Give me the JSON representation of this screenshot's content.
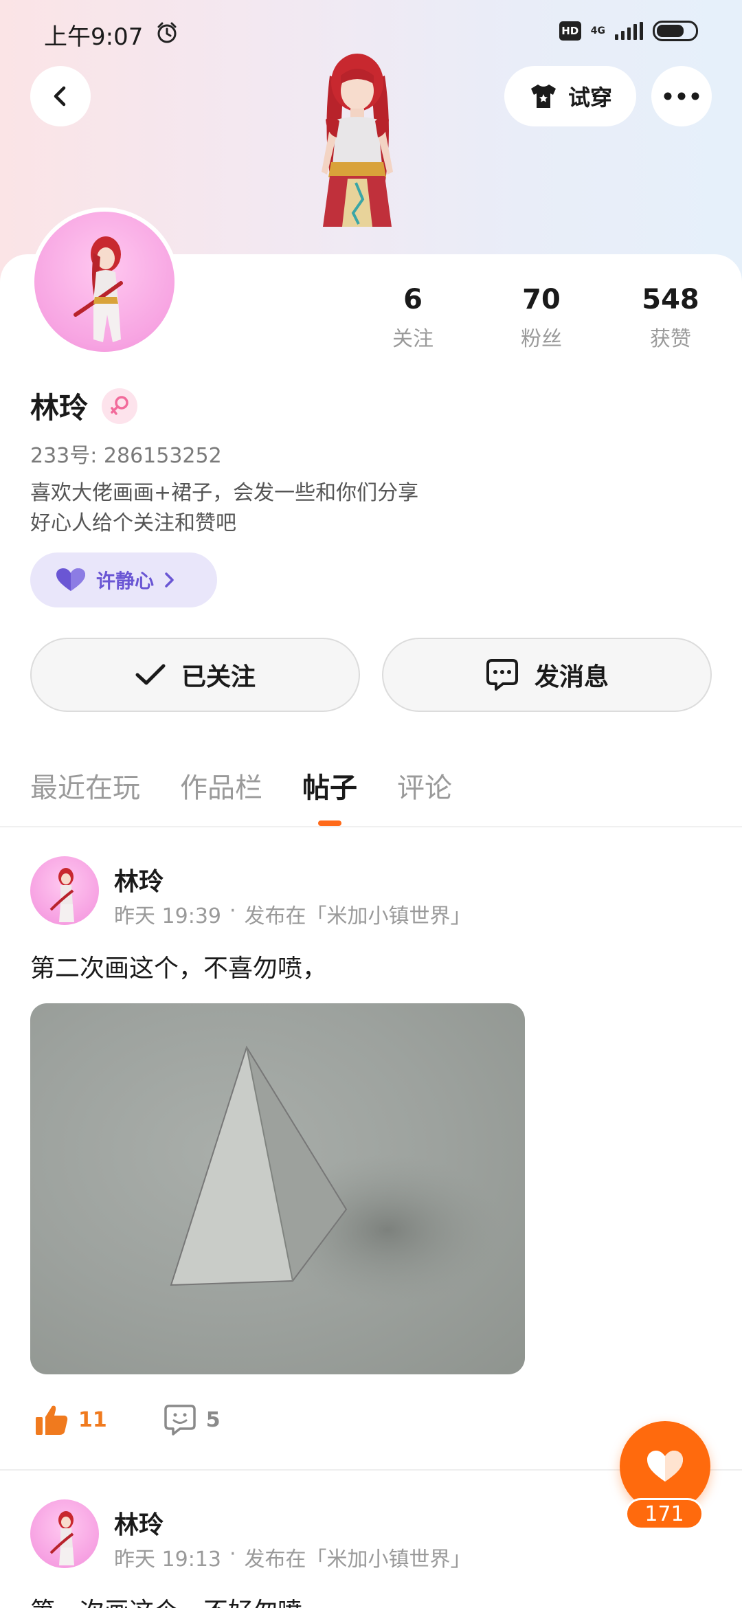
{
  "status_bar": {
    "time": "上午9:07",
    "hd": "HD",
    "network": "4G"
  },
  "header": {
    "try_on_label": "试穿"
  },
  "profile": {
    "stats": [
      {
        "value": "6",
        "label": "关注"
      },
      {
        "value": "70",
        "label": "粉丝"
      },
      {
        "value": "548",
        "label": "获赞"
      }
    ],
    "name": "林玲",
    "uid": "233号: 286153252",
    "bio_line1": "喜欢大佬画画+裙子，会发一些和你们分享",
    "bio_line2": "好心人给个关注和赞吧",
    "guild_label": "许静心"
  },
  "actions": {
    "follow_label": "已关注",
    "message_label": "发消息"
  },
  "tabs": [
    {
      "label": "最近在玩",
      "active": false
    },
    {
      "label": "作品栏",
      "active": false
    },
    {
      "label": "帖子",
      "active": true
    },
    {
      "label": "评论",
      "active": false
    }
  ],
  "posts": [
    {
      "author": "林玲",
      "time": "昨天 19:39",
      "place": "发布在「米加小镇世界」",
      "text": "第二次画这个，不喜勿喷，",
      "likes": "11",
      "comments": "5"
    },
    {
      "author": "林玲",
      "time": "昨天 19:13",
      "place": "发布在「米加小镇世界」",
      "text": "第一次画这个，不好勿喷"
    }
  ],
  "floating": {
    "like_count": "171"
  },
  "colors": {
    "accent": "#ff6a0d",
    "guild": "#6a56d4",
    "like": "#f07a1e"
  }
}
